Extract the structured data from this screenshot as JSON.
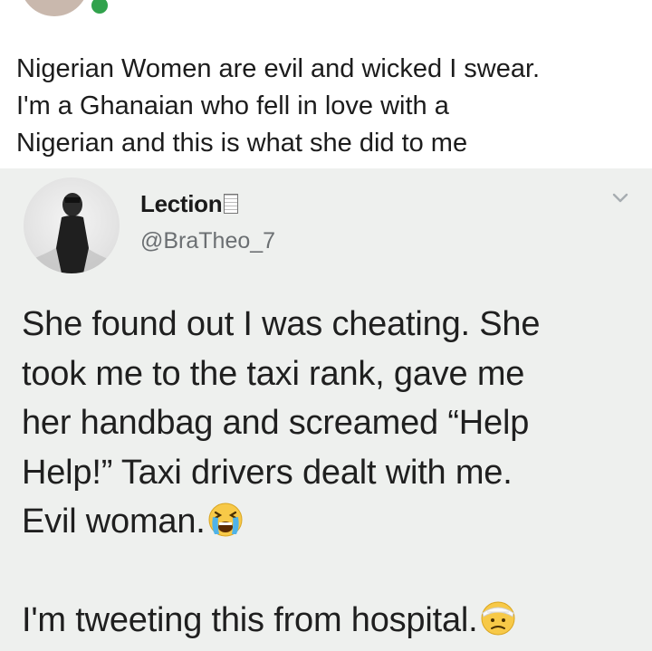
{
  "post": {
    "caption_lines": [
      "Nigerian Women are evil and wicked I swear.",
      "I'm a Ghanaian who fell in love with a",
      "Nigerian and this is what she did to me"
    ]
  },
  "tweet": {
    "display_name": "Lection",
    "handle": "@BraTheo_7",
    "body_lines": [
      "She found out I was cheating. She",
      "took me to the taxi rank, gave me",
      "her handbag and screamed “Help",
      "Help!” Taxi drivers dealt with me.",
      "Evil woman.",
      "",
      "I'm tweeting this from hospital."
    ],
    "emojis": [
      "loudly-crying-face",
      "face-with-head-bandage"
    ]
  },
  "colors": {
    "online": "#31a24c",
    "card_bg": "#eef0ee",
    "handle": "#6b6f72"
  }
}
